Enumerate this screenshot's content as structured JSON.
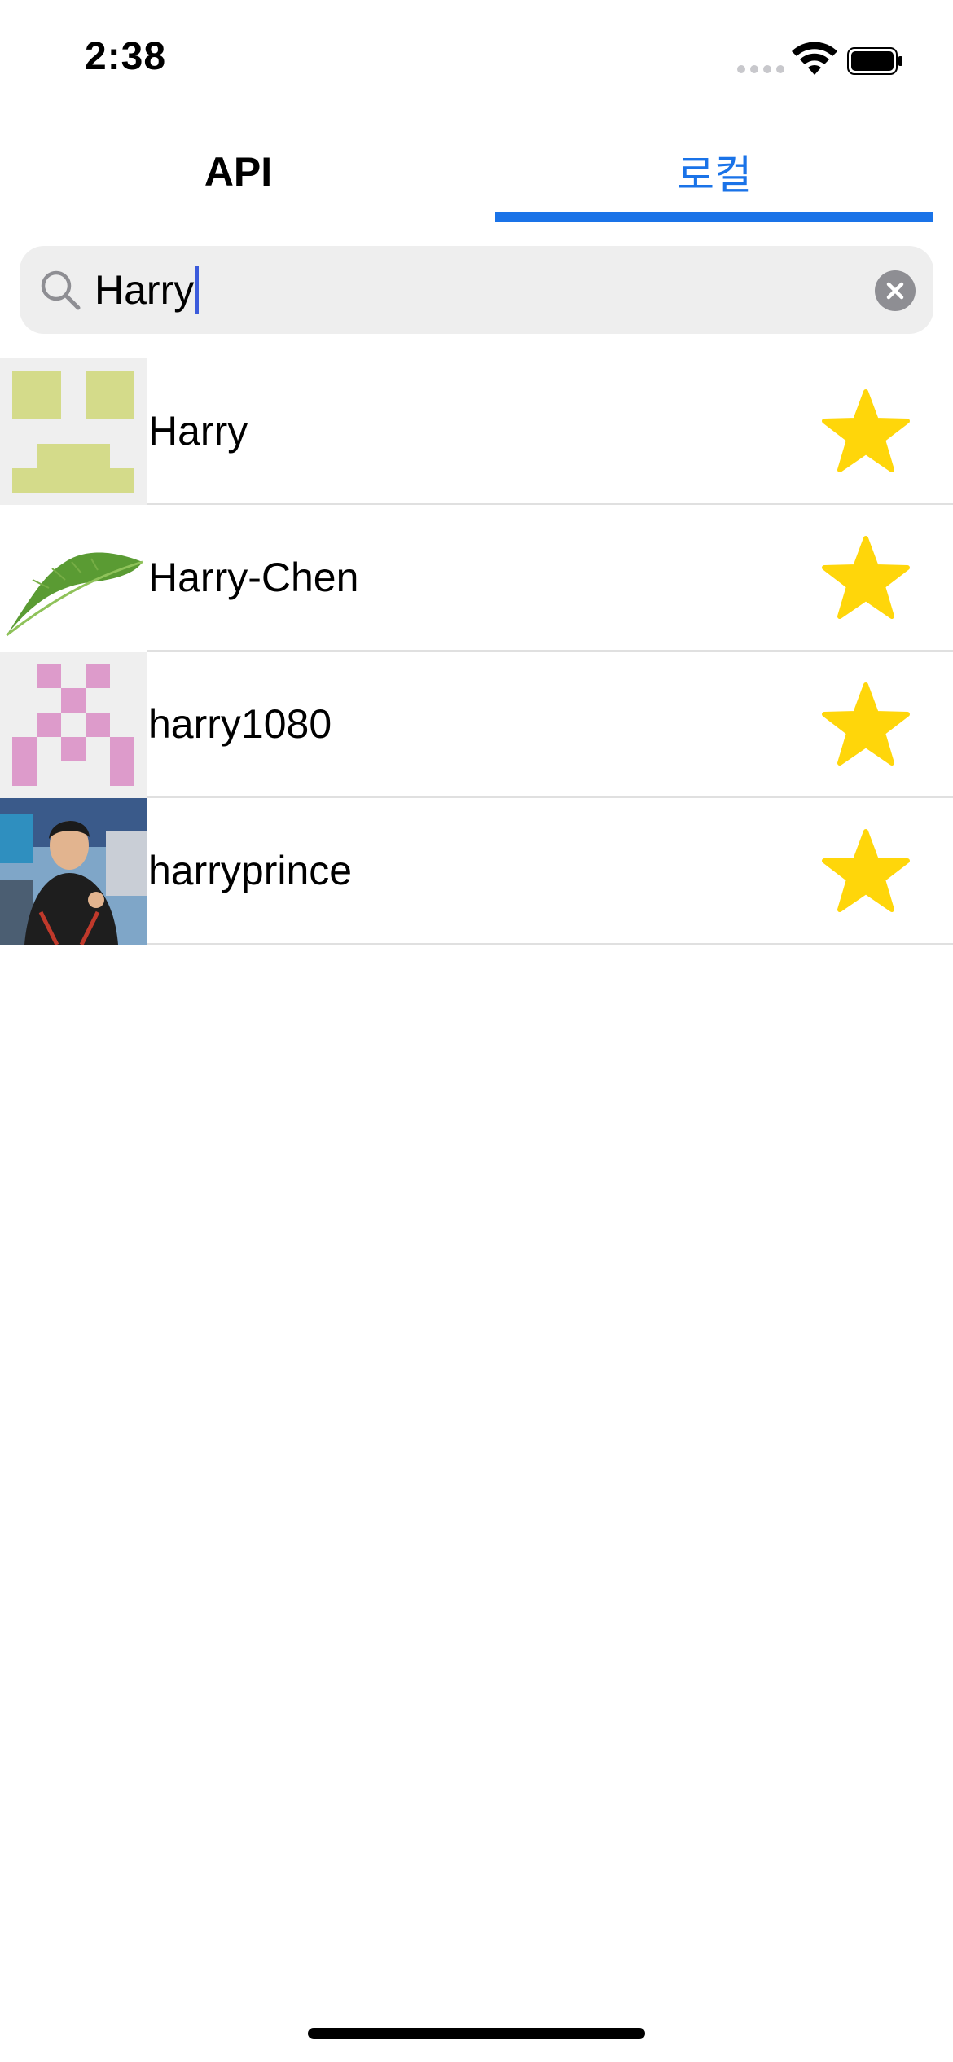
{
  "status_bar": {
    "time": "2:38"
  },
  "tabs": [
    {
      "label": "API",
      "selected": false
    },
    {
      "label": "로컬",
      "selected": true
    }
  ],
  "search": {
    "value": "Harry",
    "icon": "search-icon",
    "clear_icon": "clear-icon"
  },
  "results": [
    {
      "username": "Harry",
      "favorite": true,
      "avatar": "identicon-green"
    },
    {
      "username": "Harry-Chen",
      "favorite": true,
      "avatar": "leaf-photo"
    },
    {
      "username": "harry1080",
      "favorite": true,
      "avatar": "identicon-pink"
    },
    {
      "username": "harryprince",
      "favorite": true,
      "avatar": "person-photo"
    }
  ],
  "colors": {
    "accent": "#1a73e8",
    "star": "#ffd60a",
    "search_bg": "#eeeeee",
    "identicon_green": "#d4db8a",
    "identicon_pink": "#dd9bcb"
  }
}
